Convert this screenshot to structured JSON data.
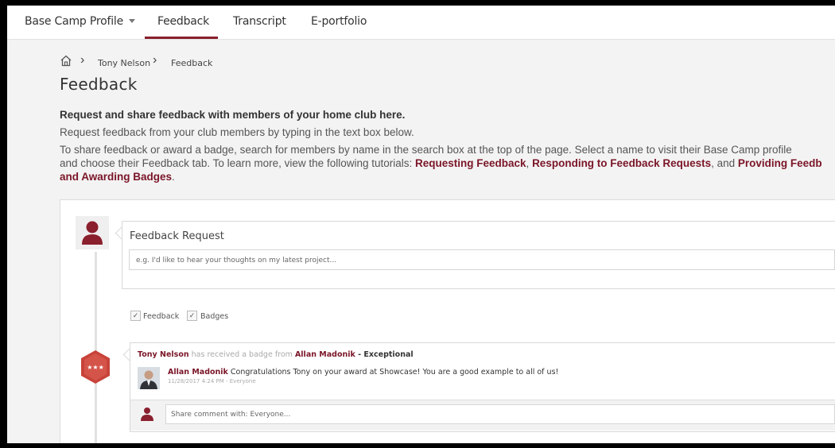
{
  "nav": {
    "tabs": [
      {
        "label": "Base Camp Profile",
        "has_dropdown": true
      },
      {
        "label": "Feedback",
        "active": true
      },
      {
        "label": "Transcript"
      },
      {
        "label": "E-portfolio"
      }
    ]
  },
  "breadcrumb": {
    "home_icon": "home-icon",
    "items": [
      "Tony Nelson",
      "Feedback"
    ]
  },
  "page": {
    "title": "Feedback",
    "intro_heading": "Request and share feedback with members of your home club here.",
    "intro_line1": "Request feedback from your club members by typing in the text box below.",
    "intro_line2_a": "To share feedback or award a badge, search for members by name in the search box at the top of the page. Select a name to visit their Base Camp profile",
    "intro_line3_a": "and choose their Feedback tab. To learn more, view the following tutorials: ",
    "link1": "Requesting Feedback",
    "sep1": ", ",
    "link2": "Responding to Feedback Requests",
    "sep2": ", and ",
    "link3a": "Providing Feedb",
    "link3b": "and Awarding Badges",
    "end": "."
  },
  "request": {
    "title": "Feedback Request",
    "placeholder": "e.g. I'd like to hear your thoughts on my latest project..."
  },
  "filters": [
    {
      "label": "Feedback",
      "checked": true
    },
    {
      "label": "Badges",
      "checked": true
    }
  ],
  "post": {
    "recipient": "Tony Nelson",
    "action": " has received a badge from ",
    "giver": "Allan Madonik",
    "badge_sep": " - ",
    "badge_name": "Exceptional",
    "comment_author": "Allan Madonik",
    "comment_text": " Congratulations Tony on your award at Showcase! You are a good example to all of us!",
    "comment_meta": "11/28/2017 4:24 PM - Everyone",
    "share_placeholder": "Share comment with: Everyone..."
  },
  "colors": {
    "accent": "#8a1f2d",
    "link": "#7a1527",
    "badge": "#c8433a"
  }
}
